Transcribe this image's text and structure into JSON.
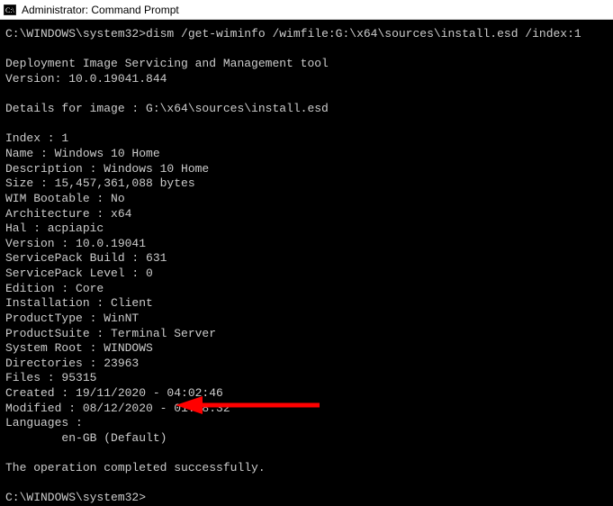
{
  "window": {
    "title": "Administrator: Command Prompt"
  },
  "prompt1": {
    "path": "C:\\WINDOWS\\system32>",
    "command": "dism /get-wiminfo /wimfile:G:\\x64\\sources\\install.esd /index:1"
  },
  "tool_header": "Deployment Image Servicing and Management tool",
  "tool_version": "Version: 10.0.19041.844",
  "details_header": "Details for image : G:\\x64\\sources\\install.esd",
  "fields": {
    "Index": "Index : 1",
    "Name": "Name : Windows 10 Home",
    "Description": "Description : Windows 10 Home",
    "Size": "Size : 15,457,361,088 bytes",
    "WIMBootable": "WIM Bootable : No",
    "Architecture": "Architecture : x64",
    "Hal": "Hal : acpiapic",
    "Version": "Version : 10.0.19041",
    "ServicePackBuild": "ServicePack Build : 631",
    "ServicePackLevel": "ServicePack Level : 0",
    "Edition": "Edition : Core",
    "Installation": "Installation : Client",
    "ProductType": "ProductType : WinNT",
    "ProductSuite": "ProductSuite : Terminal Server",
    "SystemRoot": "System Root : WINDOWS",
    "Directories": "Directories : 23963",
    "Files": "Files : 95315",
    "Created": "Created : 19/11/2020 - 04:02:46",
    "Modified": "Modified : 08/12/2020 - 01:08:32",
    "Languages": "Languages :",
    "LanguageValue": "        en-GB (Default)"
  },
  "completion": "The operation completed successfully.",
  "prompt2": "C:\\WINDOWS\\system32>",
  "arrow_color": "#ff0000"
}
